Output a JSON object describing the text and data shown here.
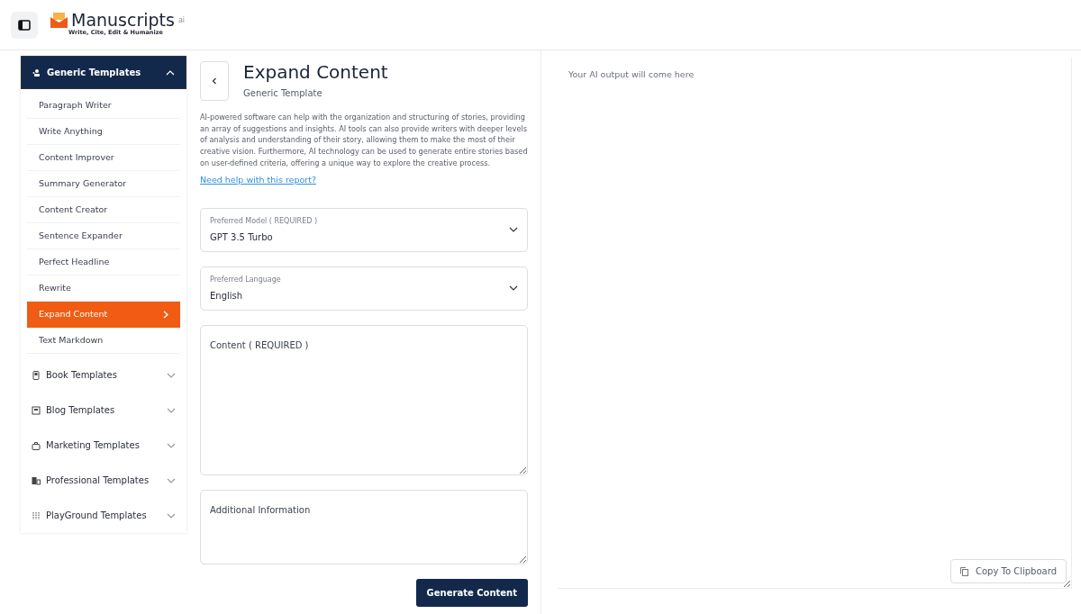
{
  "header": {
    "logo": "Manuscripts",
    "logo_suffix": "ai",
    "tagline": "Write, Cite, Edit & Humanize"
  },
  "sidebar": {
    "groups": [
      {
        "label": "Generic Templates",
        "expanded": true,
        "children": [
          {
            "label": "Paragraph Writer",
            "selected": false
          },
          {
            "label": "Write Anything",
            "selected": false
          },
          {
            "label": "Content Improver",
            "selected": false
          },
          {
            "label": "Summary Generator",
            "selected": false
          },
          {
            "label": "Content Creator",
            "selected": false
          },
          {
            "label": "Sentence Expander",
            "selected": false
          },
          {
            "label": "Perfect Headline",
            "selected": false
          },
          {
            "label": "Rewrite",
            "selected": false
          },
          {
            "label": "Expand Content",
            "selected": true
          },
          {
            "label": "Text Markdown",
            "selected": false
          }
        ]
      },
      {
        "label": "Book Templates",
        "expanded": false
      },
      {
        "label": "Blog Templates",
        "expanded": false
      },
      {
        "label": "Marketing Templates",
        "expanded": false
      },
      {
        "label": "Professional Templates",
        "expanded": false
      },
      {
        "label": "PlayGround Templates",
        "expanded": false
      }
    ]
  },
  "form": {
    "title": "Expand Content",
    "subtitle": "Generic Template",
    "description": "AI-powered software can help with the organization and structuring of stories, providing an array of suggestions and insights. AI tools can also provide writers with deeper levels of analysis and understanding of their story, allowing them to make the most of their creative vision. Furthermore, AI technology can be used to generate entire stories based on user-defined criteria, offering a unique way to explore the creative process.",
    "help_link": "Need help with this report?",
    "fields": [
      {
        "kind": "select",
        "label": "Preferred Model ( REQUIRED )",
        "value": "GPT 3.5 Turbo"
      },
      {
        "kind": "select",
        "label": "Preferred Language",
        "value": "English"
      },
      {
        "kind": "textarea",
        "placeholder": "Content ( REQUIRED )"
      },
      {
        "kind": "textarea",
        "placeholder": "Additional Information"
      }
    ],
    "submit": "Generate Content"
  },
  "output": {
    "placeholder": "Your AI output will come here",
    "copy_button": "Copy To Clipboard"
  }
}
